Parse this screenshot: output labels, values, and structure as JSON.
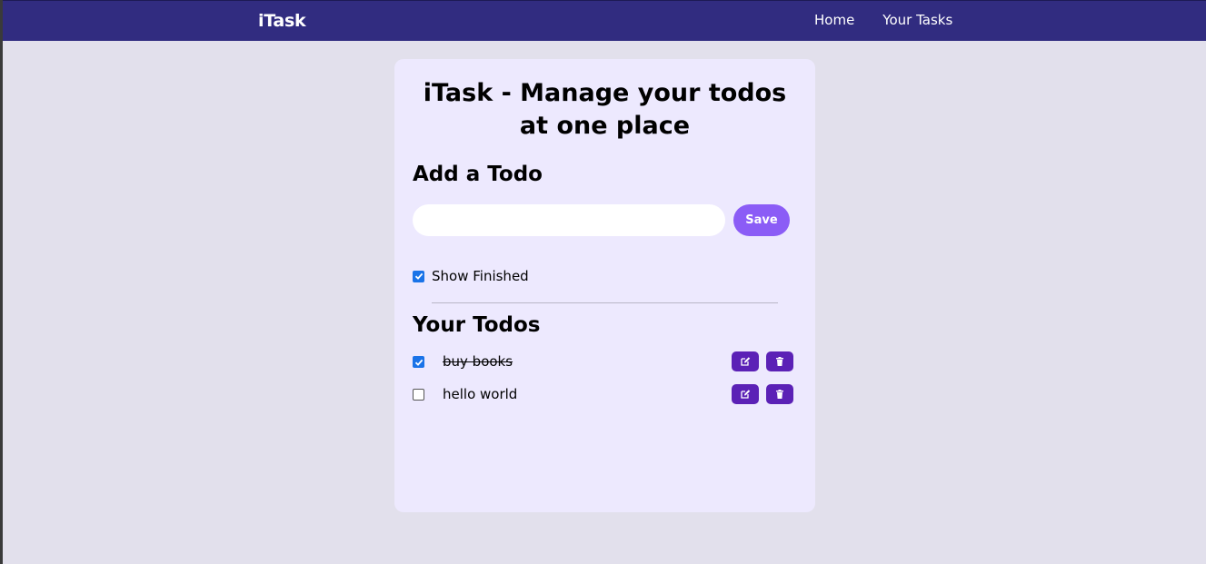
{
  "navbar": {
    "brand": "iTask",
    "links": [
      "Home",
      "Your Tasks"
    ]
  },
  "main": {
    "title": "iTask - Manage your todos at one place",
    "add_title": "Add a Todo",
    "input_value": "",
    "save_label": "Save",
    "show_finished_label": "Show Finished",
    "show_finished_checked": true,
    "todos_title": "Your Todos",
    "todos": [
      {
        "text": "buy books",
        "done": true
      },
      {
        "text": "hello world",
        "done": false
      }
    ]
  },
  "colors": {
    "navbar": "#312c80",
    "card": "#ede9fe",
    "save_button": "#8b5cf6",
    "icon_button": "#5b21b6"
  },
  "icons": {
    "edit": "edit-icon",
    "delete": "trash-icon"
  }
}
